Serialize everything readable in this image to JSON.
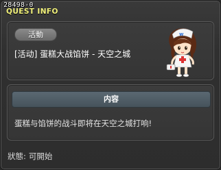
{
  "window": {
    "quest_id": "28498-0",
    "title": "QUEST INFO"
  },
  "quest": {
    "badge": "活動",
    "name": "[活动] 蛋糕大战馅饼 - 天空之城"
  },
  "content": {
    "header": "内容",
    "text": "蛋糕与馅饼的战斗即将在天空之城打响!"
  },
  "status": {
    "label": "狀態:",
    "value": "可開始"
  },
  "colors": {
    "title": "#f2f27a",
    "panel_bg": "#383838",
    "header_bar": "#52606a"
  },
  "icons": {
    "npc": "npc-nurse-girl-icon"
  }
}
